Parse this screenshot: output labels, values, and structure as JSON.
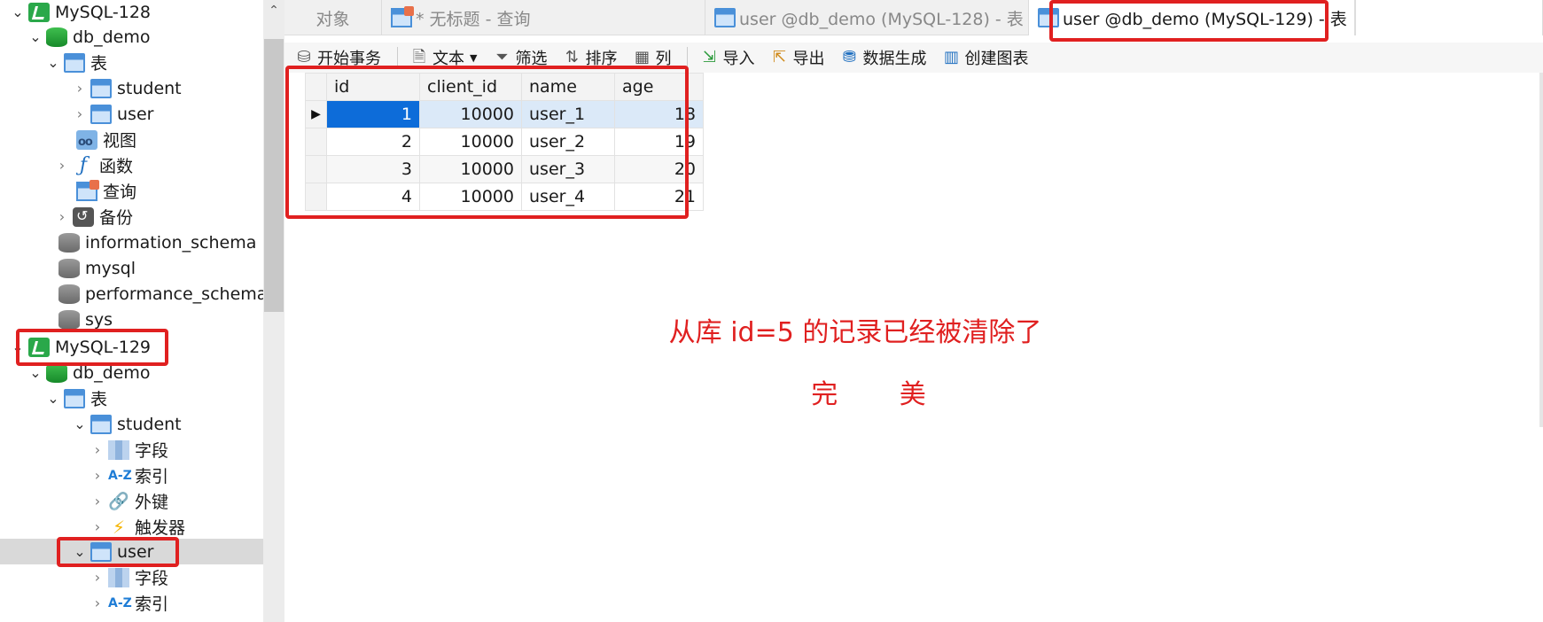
{
  "tree": {
    "conn1": "MySQL-128",
    "db1": "db_demo",
    "tables_folder": "表",
    "table_student": "student",
    "table_user": "user",
    "views": "视图",
    "functions": "函数",
    "queries": "查询",
    "backups": "备份",
    "db_info": "information_schema",
    "db_mysql": "mysql",
    "db_perf": "performance_schema",
    "db_sys": "sys",
    "conn2": "MySQL-129",
    "db2": "db_demo",
    "tables_folder2": "表",
    "student2": "student",
    "fields": "字段",
    "indexes": "索引",
    "foreign_keys": "外键",
    "triggers": "触发器",
    "user2": "user",
    "fields2": "字段",
    "indexes2": "索引",
    "index_icon": "A-Z"
  },
  "tabs": {
    "objects": "对象",
    "untitled": "* 无标题 - 查询",
    "tab128": "user @db_demo (MySQL-128) - 表",
    "tab129": "user @db_demo (MySQL-129) - 表"
  },
  "toolbar": {
    "begin_tx": "开始事务",
    "text": "文本",
    "filter": "筛选",
    "sort": "排序",
    "columns": "列",
    "import": "导入",
    "export": "导出",
    "datagen": "数据生成",
    "chart": "创建图表"
  },
  "grid": {
    "headers": [
      "id",
      "client_id",
      "name",
      "age"
    ],
    "rows": [
      [
        "1",
        "10000",
        "user_1",
        "18"
      ],
      [
        "2",
        "10000",
        "user_2",
        "19"
      ],
      [
        "3",
        "10000",
        "user_3",
        "20"
      ],
      [
        "4",
        "10000",
        "user_4",
        "21"
      ]
    ]
  },
  "annotation": {
    "line1": "从库 id=5 的记录已经被清除了",
    "line2": "完 美"
  },
  "colors": {
    "highlight": "#e02020",
    "selection": "#0d6cd9"
  }
}
